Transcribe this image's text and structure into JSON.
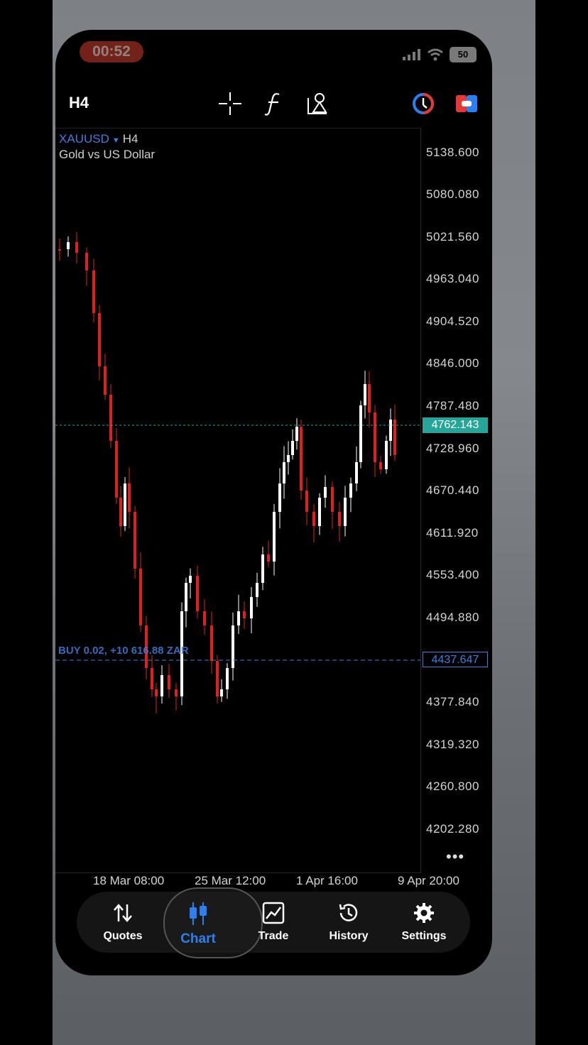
{
  "status_bar": {
    "time": "00:52",
    "battery": "50"
  },
  "toolbar": {
    "timeframe": "H4",
    "tools": [
      "crosshair-icon",
      "function-icon",
      "objects-icon",
      "one-click-trading-icon",
      "window-switch-icon"
    ]
  },
  "chart": {
    "symbol": "XAUUSD",
    "symbol_timeframe": "H4",
    "description": "Gold vs US Dollar",
    "price_axis": [
      "5138.600",
      "5080.080",
      "5021.560",
      "4963.040",
      "4904.520",
      "4846.000",
      "4787.480",
      "4728.960",
      "4670.440",
      "4611.920",
      "4553.400",
      "4494.880",
      "4437.647",
      "4377.840",
      "4319.320",
      "4260.800",
      "4202.280"
    ],
    "current_price": "4762.143",
    "position_price": "4437.647",
    "position_label": "BUY 0.02, +10 616.88 ZAR",
    "time_axis": [
      "18 Mar 08:00",
      "25 Mar 12:00",
      "1 Apr 16:00",
      "9 Apr 20:00"
    ],
    "more_label": "•••",
    "colors": {
      "bull": "#ffffff",
      "bear": "#e02020",
      "current": "#26a69a",
      "position": "#3c7fe0"
    }
  },
  "nav": {
    "items": [
      {
        "label": "Quotes",
        "icon": "quotes-arrows-icon"
      },
      {
        "label": "Chart",
        "icon": "candles-icon",
        "active": true
      },
      {
        "label": "Trade",
        "icon": "trade-chart-icon"
      },
      {
        "label": "History",
        "icon": "history-clock-icon"
      },
      {
        "label": "Settings",
        "icon": "gear-icon"
      }
    ]
  }
}
